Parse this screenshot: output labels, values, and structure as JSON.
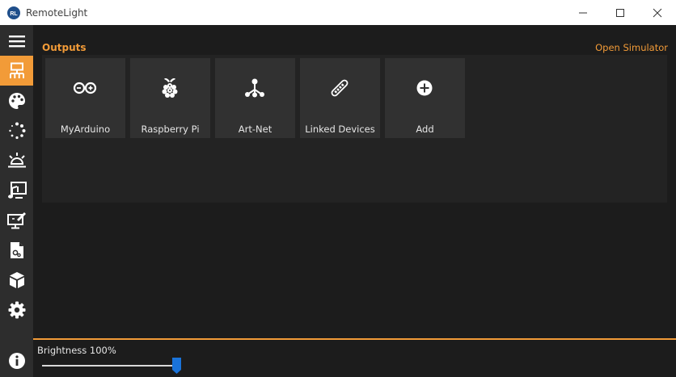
{
  "window": {
    "title": "RemoteLight",
    "logo_text": "RL"
  },
  "sidebar": {
    "items": [
      {
        "icon": "menu-icon",
        "active": false
      },
      {
        "icon": "outputs-icon",
        "active": true
      },
      {
        "icon": "palette-icon",
        "active": false
      },
      {
        "icon": "animations-icon",
        "active": false
      },
      {
        "icon": "scenes-icon",
        "active": false
      },
      {
        "icon": "music-sync-icon",
        "active": false
      },
      {
        "icon": "screen-color-icon",
        "active": false
      },
      {
        "icon": "scripts-icon",
        "active": false
      },
      {
        "icon": "plugins-icon",
        "active": false
      },
      {
        "icon": "settings-icon",
        "active": false
      },
      {
        "icon": "info-icon",
        "active": false
      }
    ]
  },
  "main": {
    "section_title": "Outputs",
    "open_simulator": "Open Simulator",
    "tiles": [
      {
        "label": "MyArduino",
        "icon": "arduino-icon"
      },
      {
        "label": "Raspberry Pi",
        "icon": "raspberry-pi-icon"
      },
      {
        "label": "Art-Net",
        "icon": "art-net-icon"
      },
      {
        "label": "Linked Devices",
        "icon": "linked-devices-icon"
      },
      {
        "label": "Add",
        "icon": "add-icon"
      }
    ]
  },
  "bottom": {
    "brightness_label": "Brightness 100%",
    "brightness_percent": 100
  },
  "colors": {
    "accent": "#f29b38",
    "sidebar": "#2d2d2d",
    "background": "#1c1c1c",
    "panel": "#232323",
    "tile": "#313131",
    "slider_thumb": "#1a73d9"
  }
}
